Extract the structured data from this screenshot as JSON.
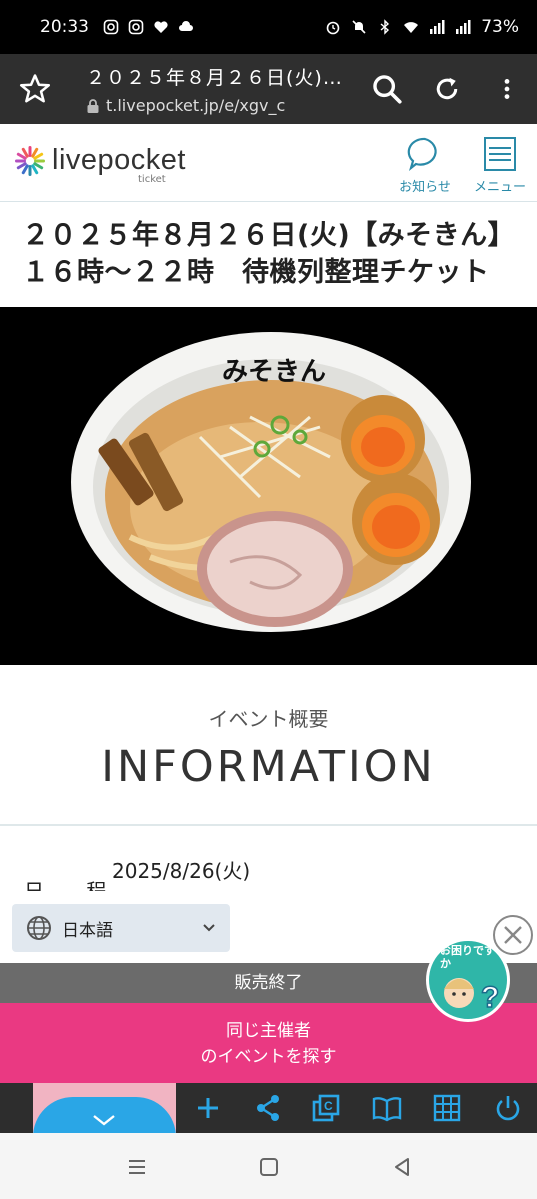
{
  "status_bar": {
    "time": "20:33",
    "battery": "73%",
    "icons_left": [
      "instagram-icon",
      "instagram-icon",
      "heart-icon",
      "cloud-icon"
    ],
    "icons_right": [
      "alarm-icon",
      "mute-icon",
      "bluetooth-icon",
      "wifi-icon",
      "signal-icon",
      "signal-icon"
    ]
  },
  "browser": {
    "page_title": "２０２５年８月２６日(火)…",
    "url": "t.livepocket.jp/e/xgv_c"
  },
  "site_header": {
    "logo": "livepocket",
    "logo_sub": "ticket",
    "news_label": "お知らせ",
    "menu_label": "メニュー"
  },
  "event": {
    "title_line1": "２０２５年８月２６日(火)【みそきん】",
    "title_line2": "１６時〜２２時　待機列整理チケット",
    "bowl_logo_text": "みそきん"
  },
  "info": {
    "subheading": "イベント概要",
    "heading": "INFORMATION",
    "schedule_label": "日 程",
    "schedule_value": "2025/8/26(火)"
  },
  "language": {
    "selected": "日本語"
  },
  "help": {
    "text": "お困りですか"
  },
  "status": {
    "sold_out": "販売終了"
  },
  "actions": {
    "search_line1": "同じ主催者",
    "search_line2": "のイベントを探す"
  },
  "colors": {
    "accent_teal": "#2a8aa8",
    "pink": "#ea3982",
    "toolbar_blue": "#2aa6e6"
  }
}
